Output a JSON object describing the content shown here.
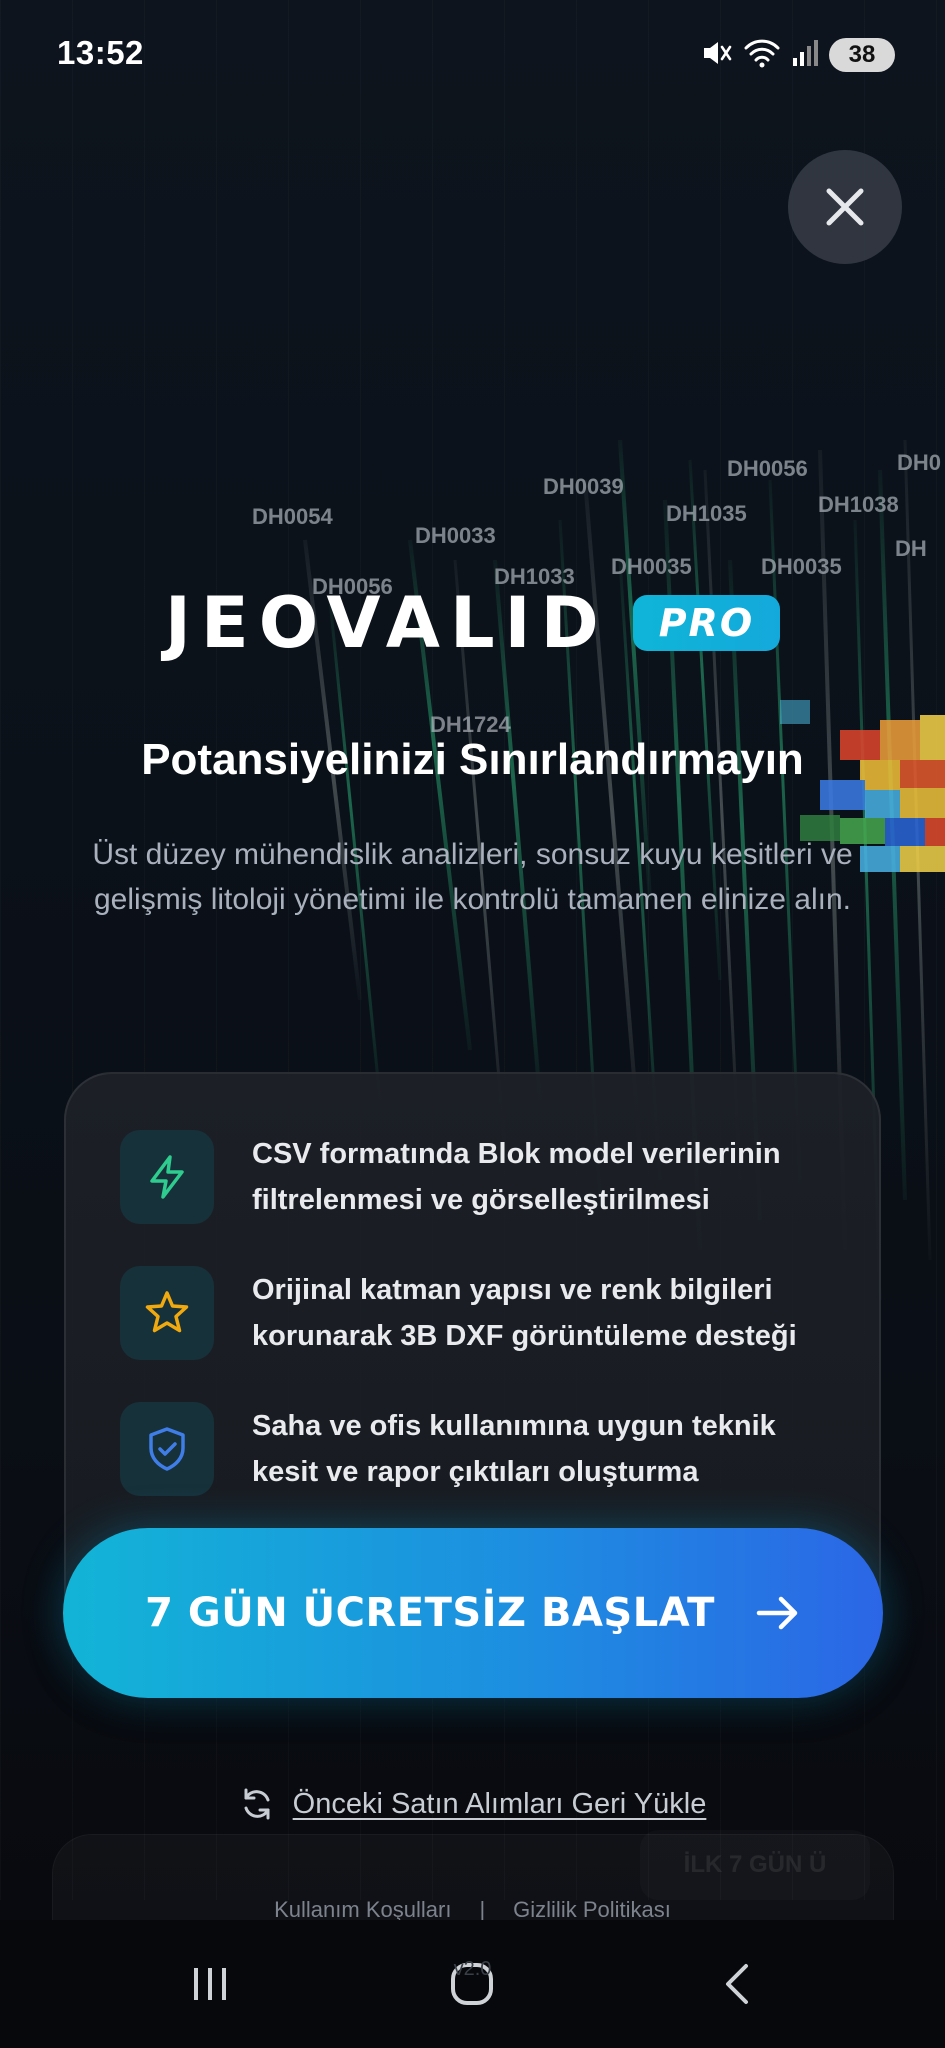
{
  "status_bar": {
    "time": "13:52",
    "battery": "38"
  },
  "background": {
    "drillhole_labels": [
      "DH0054",
      "DH0033",
      "DH0039",
      "DH1035",
      "DH0056",
      "DH1033",
      "DH0035",
      "DH0035",
      "DH0056",
      "DH1038",
      "DH0",
      "DH",
      "DH1724"
    ]
  },
  "close": {
    "icon": "close-icon"
  },
  "brand": {
    "name": "JEOVALID",
    "badge": "PRO"
  },
  "headline": "Potansiyelinizi Sınırlandırmayın",
  "subtitle": "Üst düzey mühendislik analizleri, sonsuz kuyu kesitleri ve gelişmiş litoloji yönetimi ile kontrolü tamamen elinize alın.",
  "features": [
    {
      "icon": "lightning-icon",
      "color": "#2ecc8f",
      "line1": "CSV formatında Blok model verilerinin",
      "line2": "filtrelenmesi ve görselleştirilmesi"
    },
    {
      "icon": "star-icon",
      "color": "#f0a90f",
      "line1": "Orijinal katman yapısı ve renk bilgileri",
      "line2": "korunarak 3B DXF görüntüleme desteği"
    },
    {
      "icon": "shield-check-icon",
      "color": "#3f7ee8",
      "line1": "Saha ve ofis kullanımına uygun teknik",
      "line2": "kesit ve rapor çıktıları oluşturma"
    }
  ],
  "cta": {
    "label": "7 GÜN ÜCRETSİZ BAŞLAT",
    "icon": "arrow-right-icon"
  },
  "restore": {
    "label": "Önceki Satın Alımları Geri Yükle",
    "icon": "refresh-icon"
  },
  "ghost_badge": "İLK 7 GÜN Ü",
  "footer": {
    "terms": "Kullanım Koşulları",
    "separator": "|",
    "privacy": "Gizlilik Politikası",
    "version": "v2.0"
  },
  "colors": {
    "accent_start": "#12b4d6",
    "accent_end": "#2b66e6",
    "background": "#0b0f16"
  }
}
